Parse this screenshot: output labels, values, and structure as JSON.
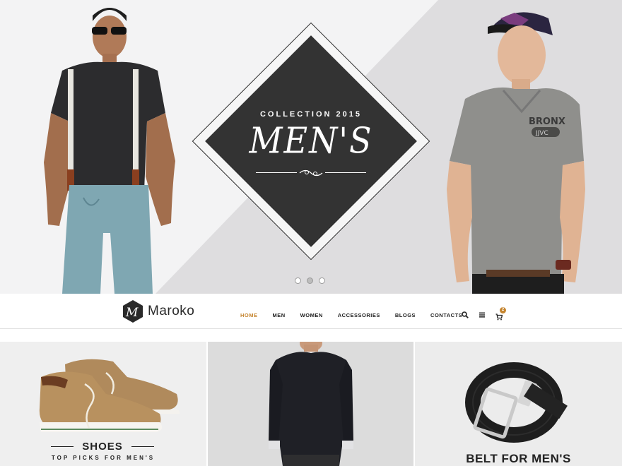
{
  "hero": {
    "collection_label": "COLLECTION 2015",
    "headline": "MEN'S",
    "slider_dots": 3,
    "active_dot": 1
  },
  "header": {
    "logo_text": "Maroko",
    "logo_badge_letter": "M",
    "nav": [
      {
        "label": "HOME",
        "active": true
      },
      {
        "label": "MEN",
        "active": false
      },
      {
        "label": "WOMEN",
        "active": false
      },
      {
        "label": "ACCESSORIES",
        "active": false
      },
      {
        "label": "BLOGS",
        "active": false
      },
      {
        "label": "CONTACTS",
        "active": false
      }
    ],
    "icons": [
      "search-icon",
      "menu-icon",
      "cart-icon"
    ],
    "cart_count": "2"
  },
  "tiles": {
    "shoes": {
      "title": "SHOES",
      "subtitle": "TOP PICKS FOR MEN'S"
    },
    "belt": {
      "title": "BELT FOR MEN'S"
    }
  },
  "colors": {
    "accent": "#c5852f",
    "diamond": "#333333",
    "hero_bg": "#ededee"
  }
}
